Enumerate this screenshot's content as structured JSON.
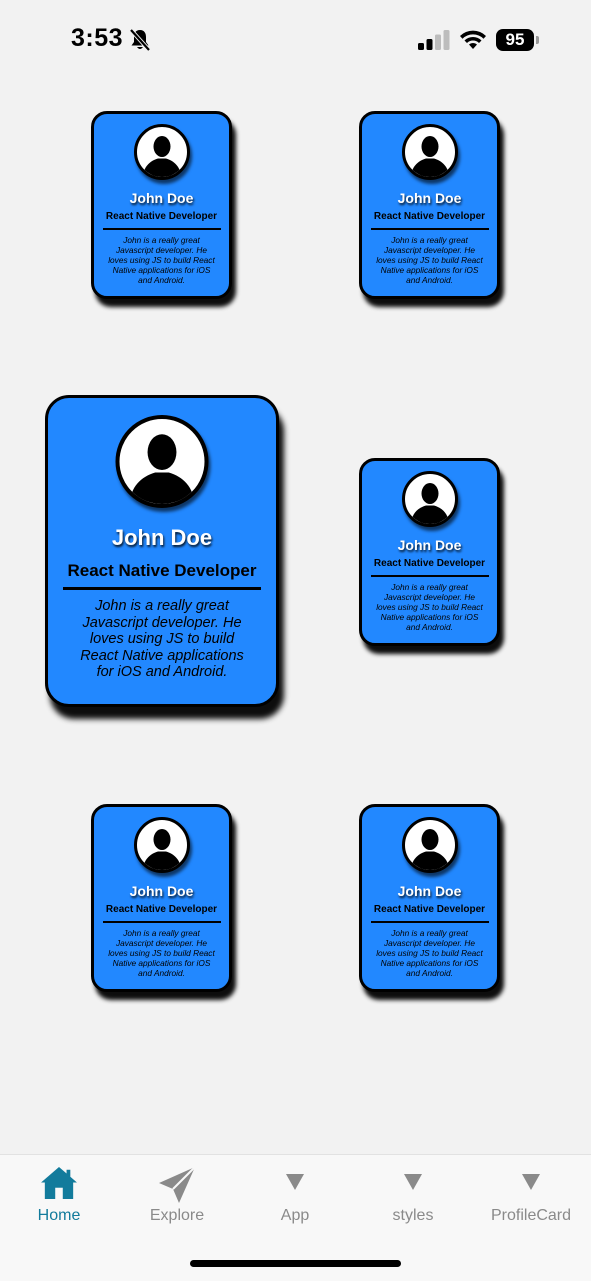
{
  "status_bar": {
    "time": "3:53",
    "battery": "95"
  },
  "cards": [
    {
      "name": "John Doe",
      "role": "React Native Developer",
      "bio": "John is a really great Javascript developer. He loves using JS to build React Native applications for iOS and Android."
    },
    {
      "name": "John Doe",
      "role": "React Native Developer",
      "bio": "John is a really great Javascript developer. He loves using JS to build React Native applications for iOS and Android."
    },
    {
      "name": "John Doe",
      "role": "React Native Developer",
      "bio": "John is a really great Javascript developer. He loves using JS to build React Native applications for iOS and Android."
    },
    {
      "name": "John Doe",
      "role": "React Native Developer",
      "bio": "John is a really great Javascript developer. He loves using JS to build React Native applications for iOS and Android."
    },
    {
      "name": "John Doe",
      "role": "React Native Developer",
      "bio": "John is a really great Javascript developer. He loves using JS to build React Native applications for iOS and Android."
    },
    {
      "name": "John Doe",
      "role": "React Native Developer",
      "bio": "John is a really great Javascript developer. He loves using JS to build React Native applications for iOS and Android."
    }
  ],
  "tabs": [
    {
      "label": "Home",
      "icon": "home-icon",
      "active": true
    },
    {
      "label": "Explore",
      "icon": "paper-plane-icon",
      "active": false
    },
    {
      "label": "App",
      "icon": "triangle-down-icon",
      "active": false
    },
    {
      "label": "styles",
      "icon": "triangle-down-icon",
      "active": false
    },
    {
      "label": "ProfileCard",
      "icon": "triangle-down-icon",
      "active": false
    }
  ],
  "colors": {
    "card": "#2288ff",
    "active_tab": "#127b9c",
    "inactive_tab": "#8a8a8a",
    "background": "#f2f2f2"
  }
}
